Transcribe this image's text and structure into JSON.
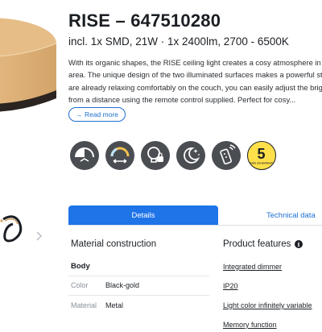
{
  "product": {
    "title": "RISE – 647510280",
    "subtitle": "incl. 1x SMD, 21W · 1x 2400lm, 2700 - 6500K",
    "description_lines": [
      "With its organic shapes, the RISE ceiling light creates a cosy atmosphere in",
      "area. The unique design of the two illuminated surfaces makes a powerful st",
      "are already relaxing comfortably on the couch, you can easily adjust the brig",
      "from a distance using the remote control supplied. Perfect for cosy..."
    ],
    "read_more_label": "Read more",
    "read_more_arrow": "→"
  },
  "feature_icons": [
    {
      "name": "dimmer-icon"
    },
    {
      "name": "color-temperature-icon"
    },
    {
      "name": "bulb-lock-icon"
    },
    {
      "name": "night-mode-icon"
    },
    {
      "name": "remote-control-icon"
    },
    {
      "name": "five-year-warranty-badge",
      "label": "5",
      "caption": "YEARS LED WARRANTY"
    }
  ],
  "tabs": {
    "details": "Details",
    "technical": "Technical data"
  },
  "material": {
    "title": "Material construction",
    "group_heading": "Body",
    "rows": [
      {
        "label": "Color",
        "value": "Black-gold"
      },
      {
        "label": "Material",
        "value": "Metal"
      }
    ]
  },
  "features": {
    "title": "Product features",
    "info_glyph": "i",
    "items": [
      "Integrated dimmer",
      "IP20",
      "Light color infinitely variable",
      "Memory function"
    ]
  },
  "colors": {
    "accent": "#1f74e8",
    "lamp_gold": "#d4a46a",
    "icon_bg": "#4a4d52",
    "badge_yellow": "#ffe04a"
  }
}
